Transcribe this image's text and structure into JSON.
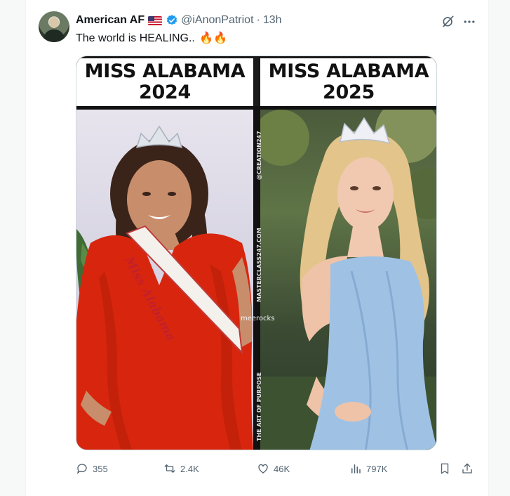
{
  "tweet": {
    "author_name": "American AF",
    "author_flag": "us-flag",
    "handle": "@iAnonPatriot",
    "separator": "·",
    "time": "13h",
    "text": "The world is HEALING..",
    "emoji": "🔥🔥"
  },
  "media": {
    "left_title_line1": "MISS ALABAMA",
    "left_title_line2": "2024",
    "right_title_line1": "MISS ALABAMA",
    "right_title_line2": "2025",
    "sash_text": "Miss Alabama",
    "watermark_top": "@CREATION247",
    "watermark_mid": "MASTERCLASS247.COM",
    "watermark_bottom": "THE ART OF PURPOSE",
    "watermark_meerocks": "meerocks"
  },
  "actions": {
    "replies": "355",
    "reposts": "2.4K",
    "likes": "46K",
    "views": "797K"
  },
  "icons": [
    "grok-icon",
    "more-icon",
    "verified-icon",
    "reply-icon",
    "repost-icon",
    "like-icon",
    "views-icon",
    "bookmark-icon",
    "share-icon"
  ],
  "colors": {
    "accent": "#1d9bf0",
    "muted_text": "#536471",
    "text": "#0f1419"
  }
}
